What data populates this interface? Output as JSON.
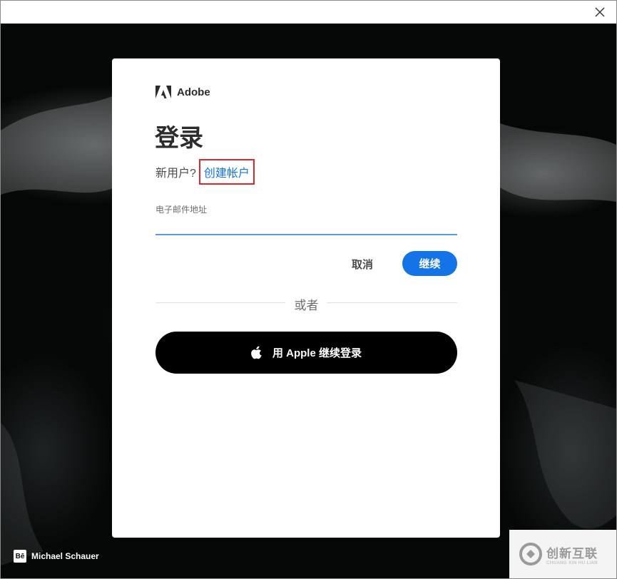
{
  "window": {
    "close_label": "✕"
  },
  "card": {
    "brand": "Adobe",
    "title": "登录",
    "new_user_prompt": "新用户?",
    "create_account_link": "创建帐户",
    "email_label": "电子邮件地址",
    "email_value": "",
    "cancel_label": "取消",
    "continue_label": "继续",
    "divider_text": "或者",
    "apple_button_label": "用 Apple 继续登录"
  },
  "background": {
    "photo_credit_badge": "Bē",
    "photo_credit": "Michael Schauer"
  },
  "watermark": {
    "main": "创新互联",
    "sub": "CHUANG XIN HU LIAN"
  },
  "colors": {
    "accent": "#1473e6",
    "highlight_border": "#e0262d",
    "apple_button": "#000000"
  }
}
